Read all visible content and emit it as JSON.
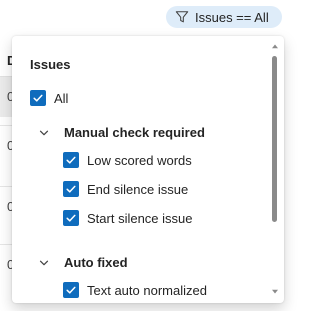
{
  "filter_pill": {
    "label": "Issues == All",
    "icon": "funnel-icon"
  },
  "background_table": {
    "header_initial": "D",
    "row_initials": [
      "0",
      "0",
      "0",
      "0"
    ]
  },
  "popup": {
    "title": "Issues",
    "all": {
      "label": "All",
      "checked": true
    },
    "groups": [
      {
        "label": "Manual check required",
        "expanded": true,
        "items": [
          {
            "label": "Low scored words",
            "checked": true
          },
          {
            "label": "End silence issue",
            "checked": true
          },
          {
            "label": "Start silence issue",
            "checked": true
          }
        ]
      },
      {
        "label": "Auto fixed",
        "expanded": true,
        "items": [
          {
            "label": "Text auto normalized",
            "checked": true
          }
        ]
      }
    ]
  },
  "colors": {
    "accent": "#0f6cbd",
    "pill_background": "#deecf9",
    "selected_row": "#ebebeb"
  }
}
